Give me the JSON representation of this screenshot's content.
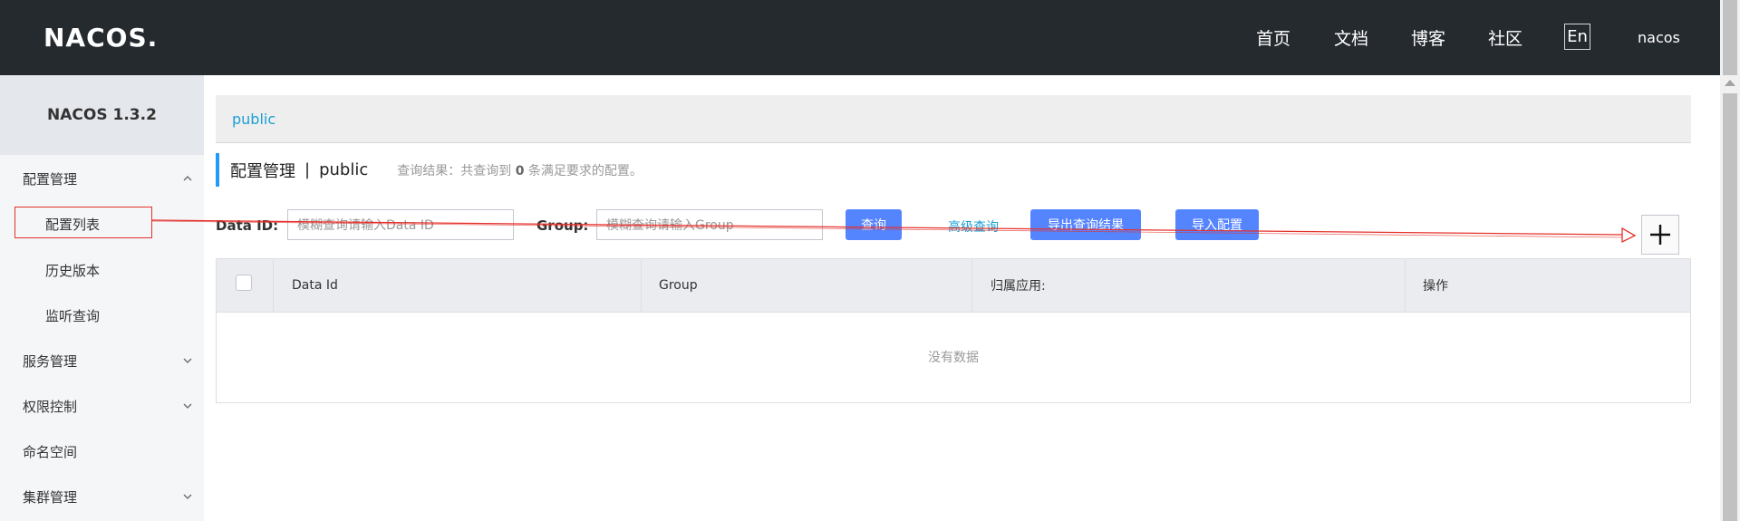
{
  "header": {
    "logo": "NACOS.",
    "nav": [
      "首页",
      "文档",
      "博客",
      "社区"
    ],
    "lang": "En",
    "user": "nacos"
  },
  "sidebar": {
    "title": "NACOS 1.3.2",
    "items": [
      {
        "label": "配置管理",
        "expanded": true
      },
      {
        "label": "配置列表",
        "sub": true,
        "selected": true
      },
      {
        "label": "历史版本",
        "sub": true
      },
      {
        "label": "监听查询",
        "sub": true
      },
      {
        "label": "服务管理",
        "expanded": false
      },
      {
        "label": "权限控制",
        "expanded": false
      },
      {
        "label": "命名空间"
      },
      {
        "label": "集群管理",
        "expanded": false
      }
    ]
  },
  "main": {
    "namespace_tab": "public",
    "title": "配置管理",
    "separator": "|",
    "namespace": "public",
    "result_prefix": "查询结果：共查询到",
    "result_count": "0",
    "result_suffix": "条满足要求的配置。",
    "data_id_label": "Data ID:",
    "data_id_placeholder": "模糊查询请输入Data ID",
    "group_label": "Group:",
    "group_placeholder": "模糊查询请输入Group",
    "query_button": "查询",
    "advanced_query": "高级查询",
    "export_button": "导出查询结果",
    "import_button": "导入配置",
    "add_button": "+"
  },
  "table": {
    "columns": [
      "Data Id",
      "Group",
      "归属应用:",
      "操作"
    ],
    "empty_text": "没有数据"
  },
  "colors": {
    "topbar": "#252a2f",
    "primary": "#5584ff",
    "link": "#1a9fd6",
    "annotation": "#e4312c"
  }
}
